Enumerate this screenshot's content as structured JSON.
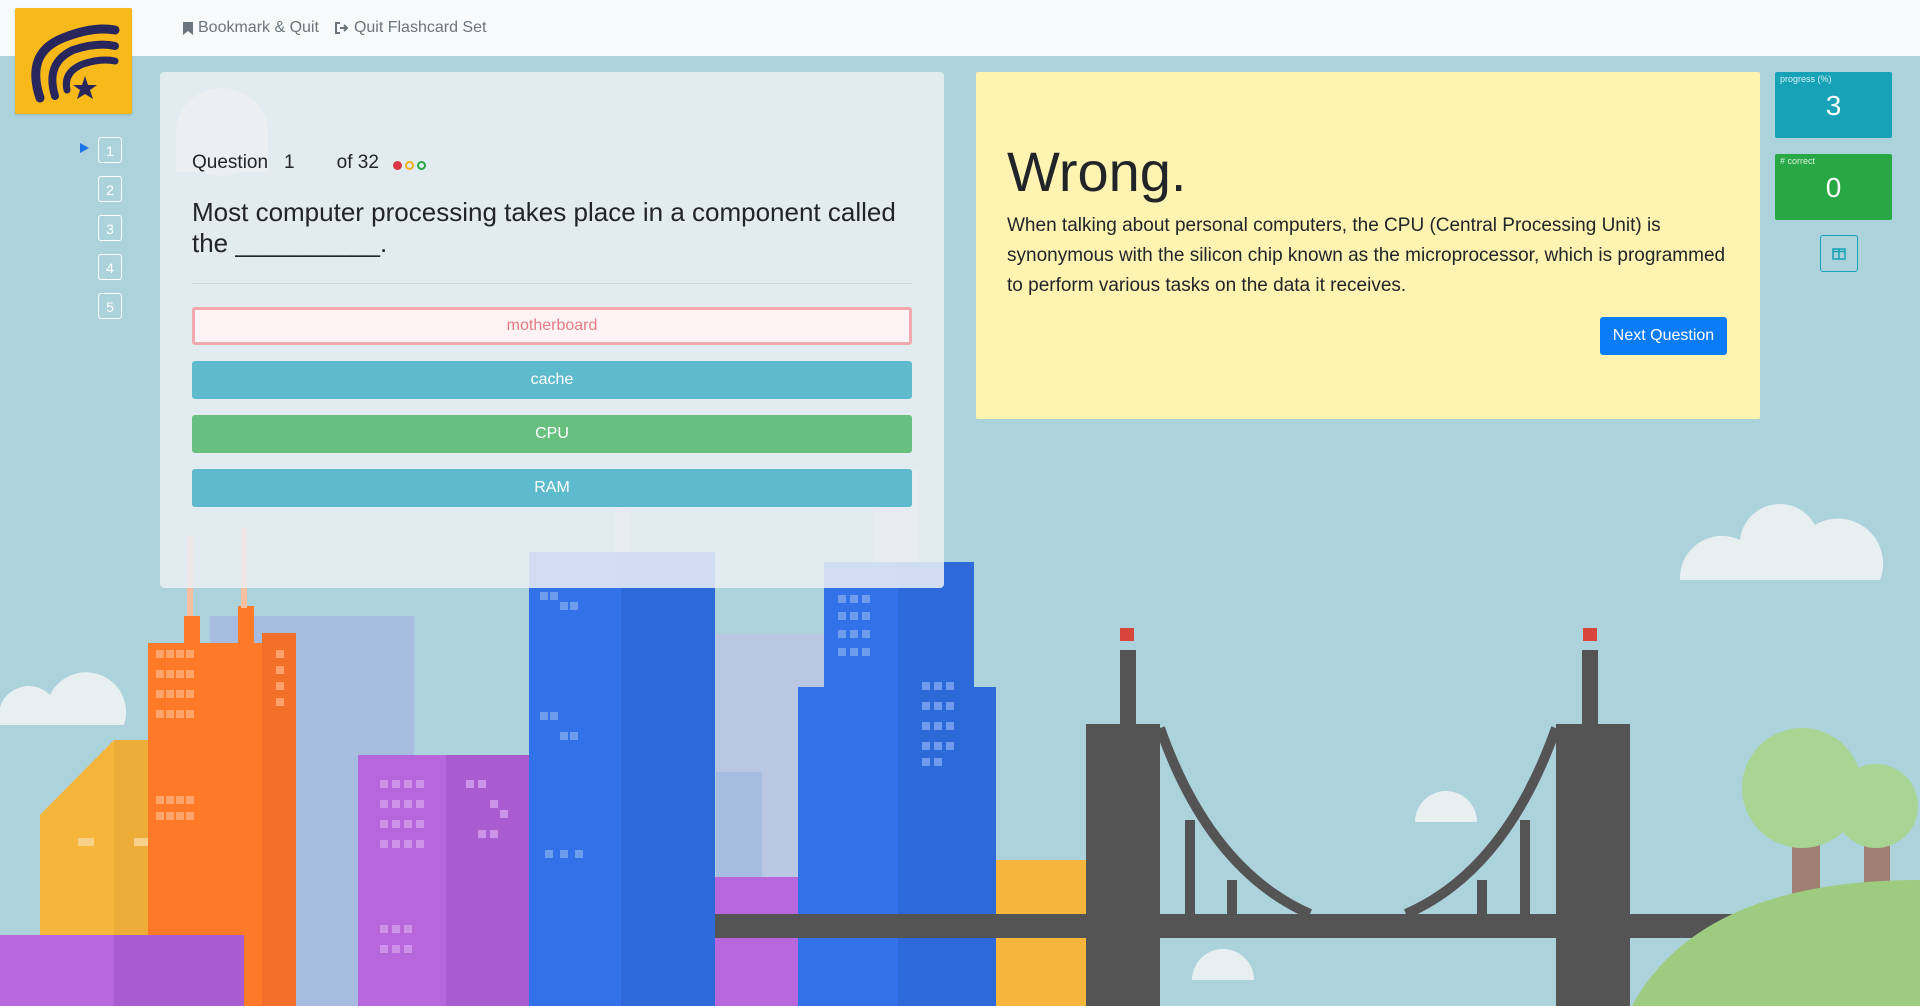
{
  "topbar": {
    "bookmark_label": "Bookmark & Quit",
    "quit_label": "Quit Flashcard Set"
  },
  "question_nav": {
    "current": 1,
    "items": [
      {
        "label": "1"
      },
      {
        "label": "2"
      },
      {
        "label": "3"
      },
      {
        "label": "4"
      },
      {
        "label": "5"
      }
    ]
  },
  "question": {
    "prefix": "Question",
    "number": "1",
    "of_label": "of 32",
    "status_dots": [
      "red-check",
      "yellow",
      "green"
    ],
    "text": "Most computer processing takes place in a component called the __________.",
    "answers": [
      {
        "label": "motherboard",
        "state": "wrong-selected"
      },
      {
        "label": "cache",
        "state": "neutral"
      },
      {
        "label": "CPU",
        "state": "correct"
      },
      {
        "label": "RAM",
        "state": "neutral"
      }
    ]
  },
  "feedback": {
    "heading": "Wrong.",
    "explanation": "When talking about personal computers, the CPU (Central Processing Unit) is synonymous with the silicon chip known as the microprocessor, which is programmed to perform various tasks on the data it receives.",
    "next_label": "Next Question"
  },
  "stats": {
    "progress_label": "progress (%)",
    "progress_value": "3",
    "correct_label": "# correct",
    "correct_value": "0"
  },
  "colors": {
    "sky": "#acd2dc",
    "logo_bg": "#f7b819",
    "progress_bg": "#17a2b8",
    "correct_bg": "#28a745",
    "next_button": "#0a7cf8",
    "feedback_bg": "#fff3b2"
  },
  "icons": {
    "bookmark": "bookmark-icon",
    "quit": "sign-out-icon",
    "layout": "columns-icon",
    "logo": "wing-star-logo"
  }
}
